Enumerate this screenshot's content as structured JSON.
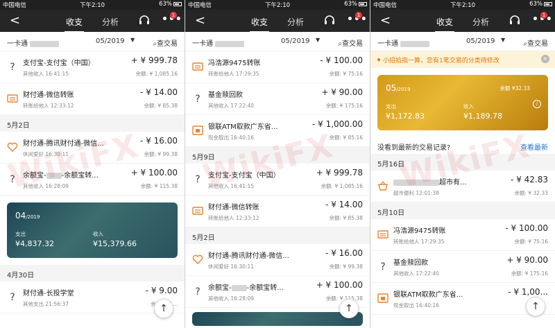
{
  "status": {
    "carrier": "中国电信",
    "time": "下午2:10",
    "battery": "63%"
  },
  "nav": {
    "back": "<",
    "tab_active": "收支",
    "tab_other": "分析",
    "more": "•••",
    "badge": "1"
  },
  "filter": {
    "card": "一卡通",
    "month": "05/2019",
    "caret": "▼",
    "query": "查交易"
  },
  "notice": {
    "text": "小招掐指一算，您有1笔交易的分类待修改",
    "close": "×"
  },
  "prompt": {
    "question": "没看到最新的交易记录?",
    "link": "查看最新"
  },
  "fab": "↑",
  "watermark": "WikiFX",
  "cards": {
    "apr": {
      "month": "04",
      "year": "/2019",
      "out_label": "支出",
      "out_value": "¥4,837.32",
      "in_label": "收入",
      "in_value": "¥15,379.66"
    },
    "may": {
      "month": "05",
      "year": "/2019",
      "balance": "余额 ¥32.33",
      "out_label": "支出",
      "out_value": "¥1,172.83",
      "in_label": "收入",
      "in_value": "¥1,189.78",
      "info": "i"
    }
  },
  "dates": {
    "d0502": "5月2日",
    "d0430": "4月30日",
    "d0509": "5月9日",
    "d0516": "5月16日",
    "d0510": "5月10日"
  },
  "tx": {
    "alipay": {
      "title": "支付宝-支付宝（中国）",
      "sub": "其他收入  16:41:15",
      "amt": "+ ¥ 999.78",
      "bal": "余额: ¥ 1,085.16"
    },
    "wechat": {
      "title": "财付通-微信转账",
      "sub": "转账给他人  12:33:12",
      "amt": "- ¥ 14.00",
      "bal": "余额: ¥ 85.38"
    },
    "tencent": {
      "title": "财付通-腾讯财付通-微信...",
      "sub": "休闲爱好  16:30:11",
      "amt": "- ¥ 16.00",
      "bal": "余额: ¥ 99.38"
    },
    "yuebao_a": "余额宝-",
    "yuebao_b": "-余额宝转...",
    "yuebao_sub": "其他收入  16:28:09",
    "yuebao_amt": "+ ¥ 100.00",
    "yuebao_bal": "余额: ¥ 115.38",
    "school": {
      "title": "财付通-长投学堂",
      "sub": "其他支出  21:56:37",
      "amt": "- ¥ 9.00",
      "bal": "余额: ¥ 1..."
    },
    "feng": {
      "title": "冯浩源9475转账",
      "sub": "转账给他人  17:29:35",
      "amt": "- ¥ 100.00",
      "bal": "余额: ¥ 75.16"
    },
    "fund": {
      "title": "基金赎回款",
      "sub": "其他收入  17:22:40",
      "amt": "+ ¥ 90.00",
      "bal": "余额: ¥ 175.16"
    },
    "atm": {
      "title": "银联ATM取款广东省...",
      "sub": "现金取出  16:40:16",
      "amt": "- ¥ 1,000.00",
      "bal": "余额: ¥ 85.16"
    },
    "atm_short_amt": "- ¥ 1,00...",
    "market_b": "超市有...",
    "market_sub": "超市便利  12:01:38",
    "market_amt": "- ¥ 42.83",
    "market_bal": "余额: ¥ 32.33"
  }
}
